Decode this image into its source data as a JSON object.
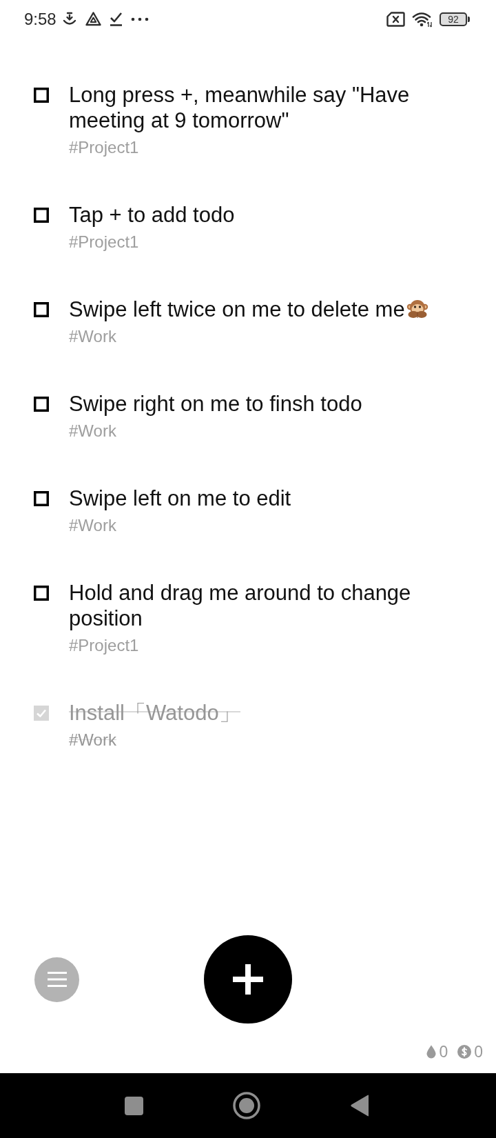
{
  "status_bar": {
    "time": "9:58",
    "battery": "92"
  },
  "todos": [
    {
      "title": "Long press +, meanwhile say \"Have meeting at 9 tomorrow\"",
      "tag": "#Project1",
      "done": false,
      "emoji": false
    },
    {
      "title": "Tap + to add todo",
      "tag": "#Project1",
      "done": false,
      "emoji": false
    },
    {
      "title": "Swipe left twice on me to delete me",
      "tag": "#Work",
      "done": false,
      "emoji": true
    },
    {
      "title": "Swipe right on me to finsh todo",
      "tag": "#Work",
      "done": false,
      "emoji": false
    },
    {
      "title": "Swipe left on me to edit",
      "tag": "#Work",
      "done": false,
      "emoji": false
    },
    {
      "title": "Hold and drag me around to change position",
      "tag": "#Project1",
      "done": false,
      "emoji": false
    },
    {
      "title": "Install「Watodo」",
      "tag": "#Work",
      "done": true,
      "emoji": false
    }
  ],
  "stats": [
    {
      "kind": "drops",
      "value": "0"
    },
    {
      "kind": "coins",
      "value": "0"
    }
  ]
}
